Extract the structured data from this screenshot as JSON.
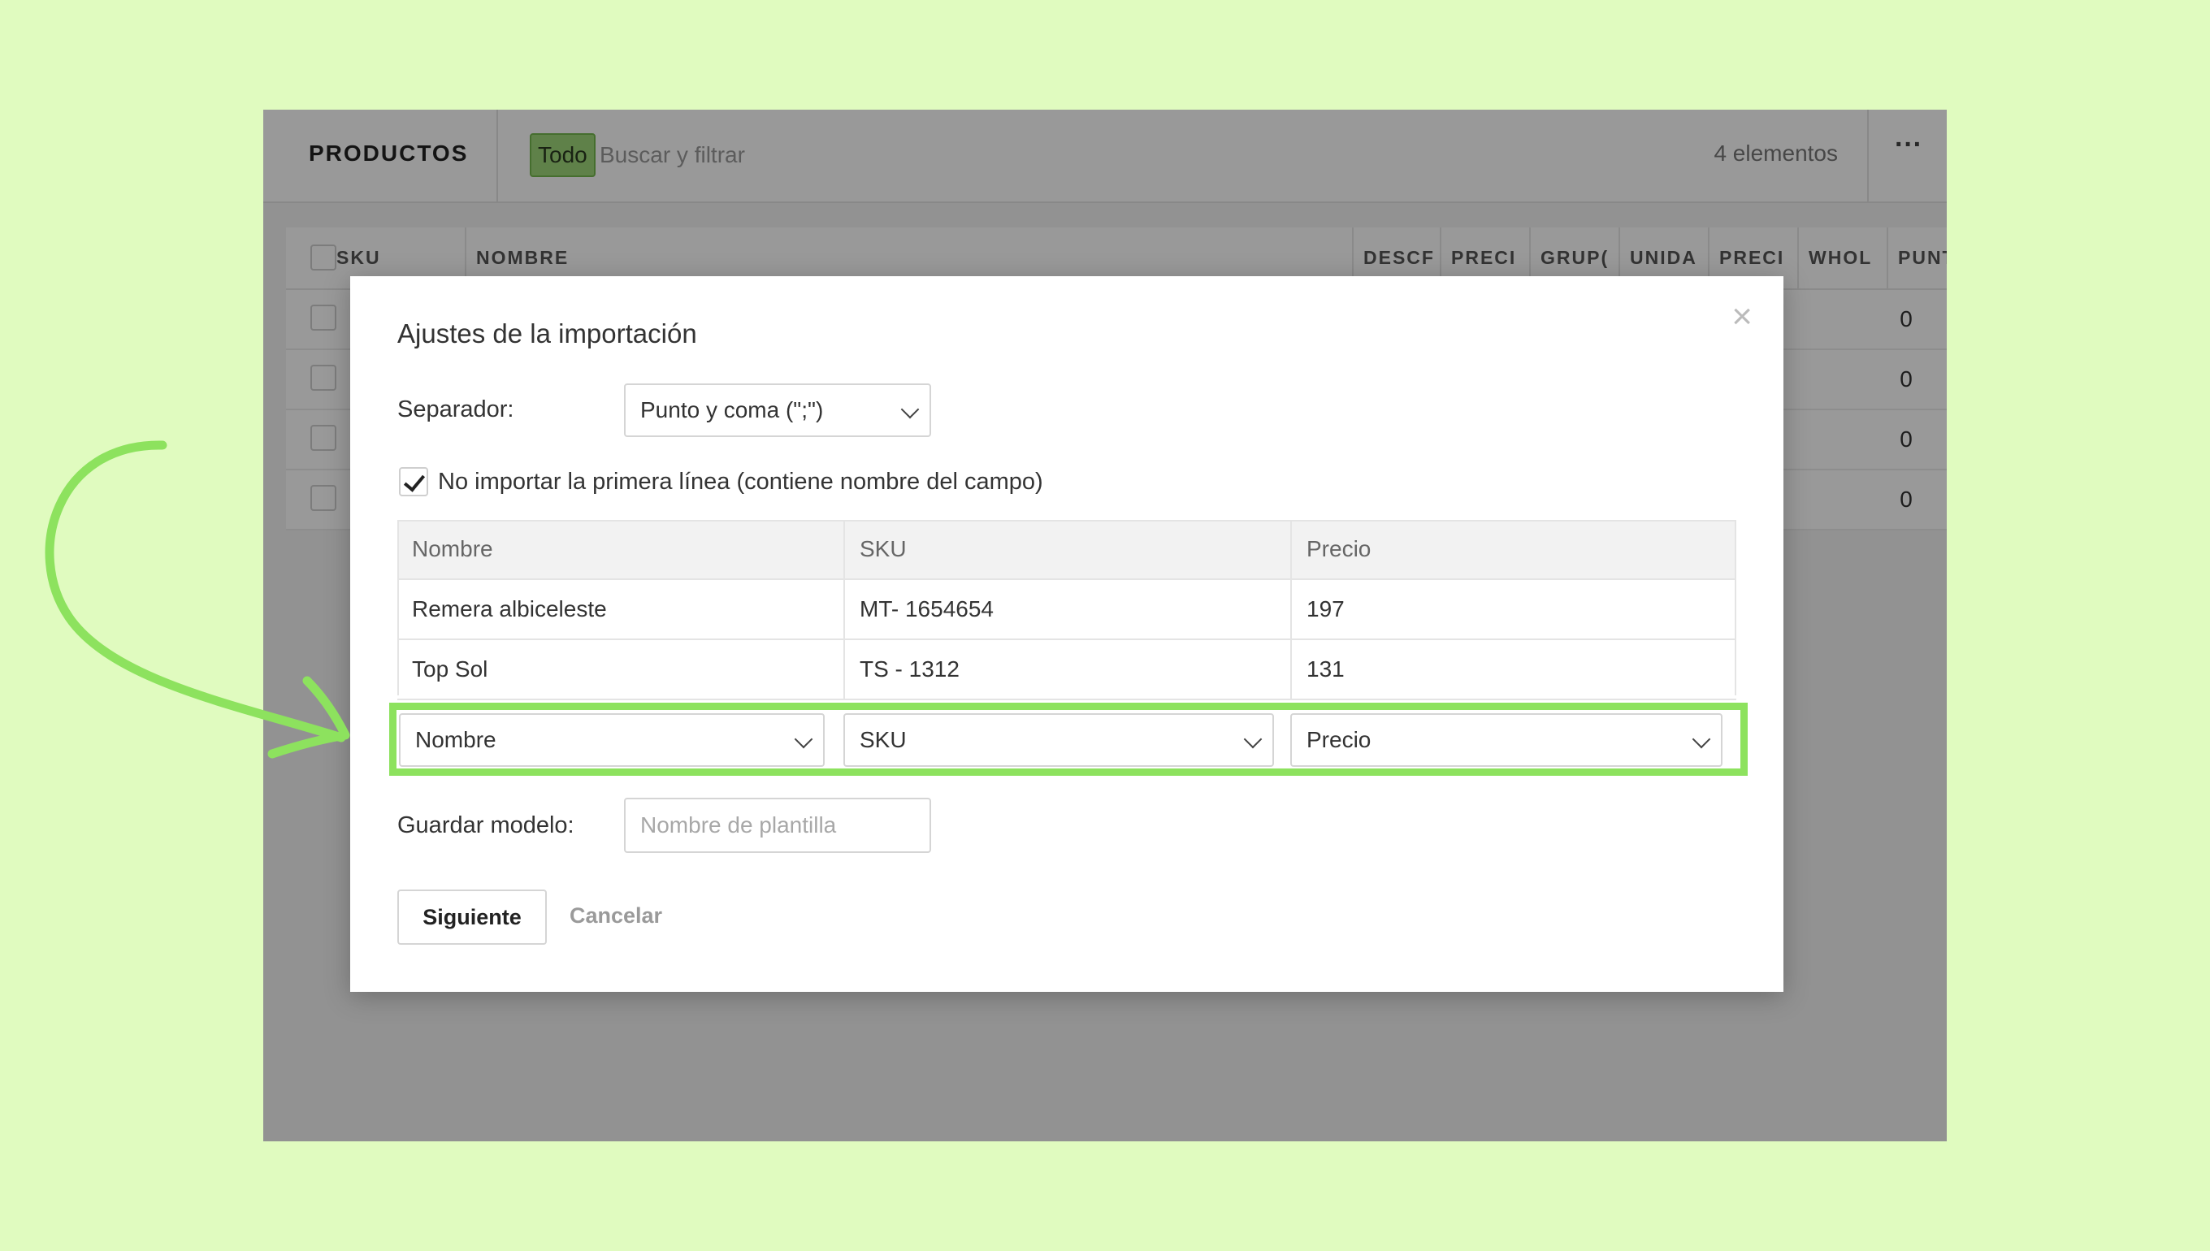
{
  "app": {
    "title": "PRODUCTOS",
    "filter_chip": "Todo",
    "search_placeholder": "Buscar y filtrar",
    "item_count": "4 elementos",
    "more_icon": "ellipsis-icon"
  },
  "table": {
    "columns": [
      "SKU",
      "NOMBRE",
      "DESCF",
      "PRECI",
      "GRUP(",
      "UNIDA",
      "PRECI",
      "WHOL",
      "PUNT"
    ],
    "rows": [
      {
        "whol": "0"
      },
      {
        "whol": "0"
      },
      {
        "whol": "0"
      },
      {
        "whol": "0"
      }
    ]
  },
  "modal": {
    "title": "Ajustes de la importación",
    "close_icon": "close-icon",
    "separator_label": "Separador:",
    "separator_value": "Punto y coma (\";\")",
    "skip_first_line_label": "No importar la primera línea (contiene nombre del campo)",
    "skip_first_line_checked": true,
    "preview": {
      "headers": [
        "Nombre",
        "SKU",
        "Precio"
      ],
      "rows": [
        [
          "Remera albiceleste",
          "MT- 1654654",
          "197"
        ],
        [
          "Top Sol",
          "TS - 1312",
          "131"
        ]
      ]
    },
    "mapping": [
      "Nombre",
      "SKU",
      "Precio"
    ],
    "save_template_label": "Guardar modelo:",
    "save_template_placeholder": "Nombre de plantilla",
    "next_button": "Siguiente",
    "cancel_button": "Cancelar"
  },
  "annotation": {
    "highlight_color": "#8de25e",
    "arrow_color": "#8de25e"
  }
}
